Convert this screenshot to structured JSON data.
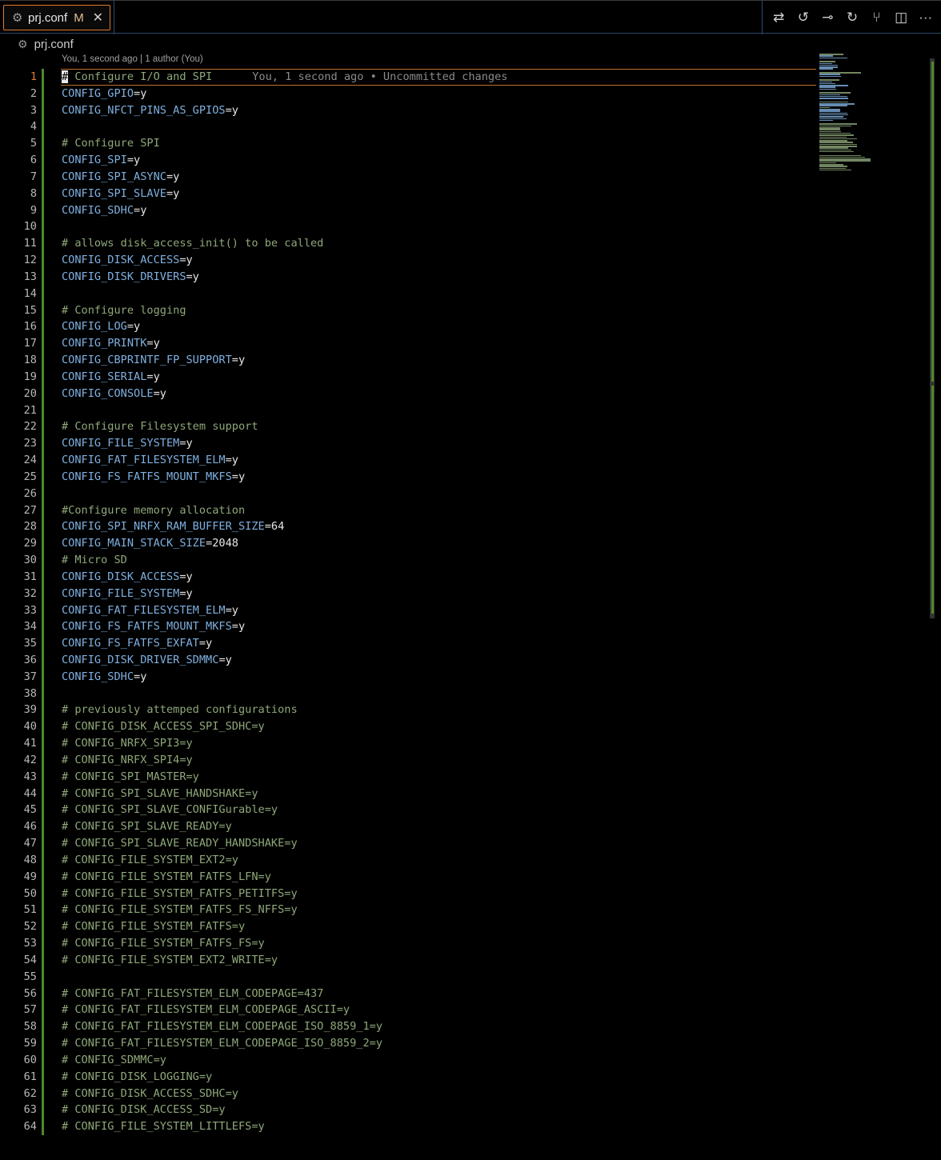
{
  "tab": {
    "icon": "gear-icon",
    "label": "prj.conf",
    "modified": "M",
    "close_icon": "close-icon"
  },
  "actions": [
    {
      "name": "open-changes-button",
      "icon": "compare-changes-icon",
      "glyph": "⇄"
    },
    {
      "name": "previous-change-button",
      "icon": "previous-change-icon",
      "glyph": "↺"
    },
    {
      "name": "commit-button",
      "icon": "git-commit-icon",
      "glyph": "⊸"
    },
    {
      "name": "next-change-button",
      "icon": "next-change-icon",
      "glyph": "↻"
    },
    {
      "name": "git-graph-button",
      "icon": "git-graph-icon",
      "glyph": "⑂"
    },
    {
      "name": "split-editor-button",
      "icon": "split-editor-icon",
      "glyph": "◫"
    },
    {
      "name": "more-actions-button",
      "icon": "more-icon",
      "glyph": "···"
    }
  ],
  "breadcrumb": {
    "icon": "gear-icon",
    "label": "prj.conf"
  },
  "codelens": "You, 1 second ago | 1 author (You)",
  "inline_blame": "You, 1 second ago • Uncommitted changes",
  "colors": {
    "accent": "#e07a30",
    "gutter_added": "#4d8a2a",
    "key": "#7fb0e0",
    "comment": "#8fa87a"
  },
  "lines": [
    {
      "n": "1",
      "t": "c",
      "text": "# Configure I/O and SPI"
    },
    {
      "n": "2",
      "t": "kv",
      "key": "CONFIG_GPIO",
      "val": "=y"
    },
    {
      "n": "3",
      "t": "kv",
      "key": "CONFIG_NFCT_PINS_AS_GPIOS",
      "val": "=y"
    },
    {
      "n": "4",
      "t": "e"
    },
    {
      "n": "5",
      "t": "c",
      "text": "# Configure SPI"
    },
    {
      "n": "6",
      "t": "kv",
      "key": "CONFIG_SPI",
      "val": "=y"
    },
    {
      "n": "7",
      "t": "kv",
      "key": "CONFIG_SPI_ASYNC",
      "val": "=y"
    },
    {
      "n": "8",
      "t": "kv",
      "key": "CONFIG_SPI_SLAVE",
      "val": "=y"
    },
    {
      "n": "9",
      "t": "kv",
      "key": "CONFIG_SDHC",
      "val": "=y"
    },
    {
      "n": "10",
      "t": "e"
    },
    {
      "n": "11",
      "t": "c",
      "text": "# allows disk_access_init() to be called"
    },
    {
      "n": "12",
      "t": "kv",
      "key": "CONFIG_DISK_ACCESS",
      "val": "=y"
    },
    {
      "n": "13",
      "t": "kv",
      "key": "CONFIG_DISK_DRIVERS",
      "val": "=y"
    },
    {
      "n": "14",
      "t": "e"
    },
    {
      "n": "15",
      "t": "c",
      "text": "# Configure logging"
    },
    {
      "n": "16",
      "t": "kv",
      "key": "CONFIG_LOG",
      "val": "=y"
    },
    {
      "n": "17",
      "t": "kv",
      "key": "CONFIG_PRINTK",
      "val": "=y"
    },
    {
      "n": "18",
      "t": "kv",
      "key": "CONFIG_CBPRINTF_FP_SUPPORT",
      "val": "=y"
    },
    {
      "n": "19",
      "t": "kv",
      "key": "CONFIG_SERIAL",
      "val": "=y"
    },
    {
      "n": "20",
      "t": "kv",
      "key": "CONFIG_CONSOLE",
      "val": "=y"
    },
    {
      "n": "21",
      "t": "e"
    },
    {
      "n": "22",
      "t": "c",
      "text": "# Configure Filesystem support"
    },
    {
      "n": "23",
      "t": "kv",
      "key": "CONFIG_FILE_SYSTEM",
      "val": "=y"
    },
    {
      "n": "24",
      "t": "kv",
      "key": "CONFIG_FAT_FILESYSTEM_ELM",
      "val": "=y"
    },
    {
      "n": "25",
      "t": "kv",
      "key": "CONFIG_FS_FATFS_MOUNT_MKFS",
      "val": "=y"
    },
    {
      "n": "26",
      "t": "e"
    },
    {
      "n": "27",
      "t": "c",
      "text": "#Configure memory allocation"
    },
    {
      "n": "28",
      "t": "kv",
      "key": "CONFIG_SPI_NRFX_RAM_BUFFER_SIZE",
      "val": "=64"
    },
    {
      "n": "29",
      "t": "kv",
      "key": "CONFIG_MAIN_STACK_SIZE",
      "val": "=2048"
    },
    {
      "n": "30",
      "t": "c",
      "text": "# Micro SD"
    },
    {
      "n": "31",
      "t": "kv",
      "key": "CONFIG_DISK_ACCESS",
      "val": "=y"
    },
    {
      "n": "32",
      "t": "kv",
      "key": "CONFIG_FILE_SYSTEM",
      "val": "=y"
    },
    {
      "n": "33",
      "t": "kv",
      "key": "CONFIG_FAT_FILESYSTEM_ELM",
      "val": "=y"
    },
    {
      "n": "34",
      "t": "kv",
      "key": "CONFIG_FS_FATFS_MOUNT_MKFS",
      "val": "=y"
    },
    {
      "n": "35",
      "t": "kv",
      "key": "CONFIG_FS_FATFS_EXFAT",
      "val": "=y"
    },
    {
      "n": "36",
      "t": "kv",
      "key": "CONFIG_DISK_DRIVER_SDMMC",
      "val": "=y"
    },
    {
      "n": "37",
      "t": "kv",
      "key": "CONFIG_SDHC",
      "val": "=y"
    },
    {
      "n": "38",
      "t": "e"
    },
    {
      "n": "39",
      "t": "c",
      "text": "# previously attemped configurations"
    },
    {
      "n": "40",
      "t": "c",
      "text": "# CONFIG_DISK_ACCESS_SPI_SDHC=y"
    },
    {
      "n": "41",
      "t": "c",
      "text": "# CONFIG_NRFX_SPI3=y"
    },
    {
      "n": "42",
      "t": "c",
      "text": "# CONFIG_NRFX_SPI4=y"
    },
    {
      "n": "43",
      "t": "c",
      "text": "# CONFIG_SPI_MASTER=y"
    },
    {
      "n": "44",
      "t": "c",
      "text": "# CONFIG_SPI_SLAVE_HANDSHAKE=y"
    },
    {
      "n": "45",
      "t": "c",
      "text": "# CONFIG_SPI_SLAVE_CONFIGurable=y"
    },
    {
      "n": "46",
      "t": "c",
      "text": "# CONFIG_SPI_SLAVE_READY=y"
    },
    {
      "n": "47",
      "t": "c",
      "text": "# CONFIG_SPI_SLAVE_READY_HANDSHAKE=y"
    },
    {
      "n": "48",
      "t": "c",
      "text": "# CONFIG_FILE_SYSTEM_EXT2=y"
    },
    {
      "n": "49",
      "t": "c",
      "text": "# CONFIG_FILE_SYSTEM_FATFS_LFN=y"
    },
    {
      "n": "50",
      "t": "c",
      "text": "# CONFIG_FILE_SYSTEM_FATFS_PETITFS=y"
    },
    {
      "n": "51",
      "t": "c",
      "text": "# CONFIG_FILE_SYSTEM_FATFS_FS_NFFS=y"
    },
    {
      "n": "52",
      "t": "c",
      "text": "# CONFIG_FILE_SYSTEM_FATFS=y"
    },
    {
      "n": "53",
      "t": "c",
      "text": "# CONFIG_FILE_SYSTEM_FATFS_FS=y"
    },
    {
      "n": "54",
      "t": "c",
      "text": "# CONFIG_FILE_SYSTEM_EXT2_WRITE=y"
    },
    {
      "n": "55",
      "t": "e"
    },
    {
      "n": "56",
      "t": "c",
      "text": "# CONFIG_FAT_FILESYSTEM_ELM_CODEPAGE=437"
    },
    {
      "n": "57",
      "t": "c",
      "text": "# CONFIG_FAT_FILESYSTEM_ELM_CODEPAGE_ASCII=y"
    },
    {
      "n": "58",
      "t": "c",
      "text": "# CONFIG_FAT_FILESYSTEM_ELM_CODEPAGE_ISO_8859_1=y"
    },
    {
      "n": "59",
      "t": "c",
      "text": "# CONFIG_FAT_FILESYSTEM_ELM_CODEPAGE_ISO_8859_2=y"
    },
    {
      "n": "60",
      "t": "c",
      "text": "# CONFIG_SDMMC=y"
    },
    {
      "n": "61",
      "t": "c",
      "text": "# CONFIG_DISK_LOGGING=y"
    },
    {
      "n": "62",
      "t": "c",
      "text": "# CONFIG_DISK_ACCESS_SDHC=y"
    },
    {
      "n": "63",
      "t": "c",
      "text": "# CONFIG_DISK_ACCESS_SD=y"
    },
    {
      "n": "64",
      "t": "c",
      "text": "# CONFIG_FILE_SYSTEM_LITTLEFS=y"
    }
  ]
}
